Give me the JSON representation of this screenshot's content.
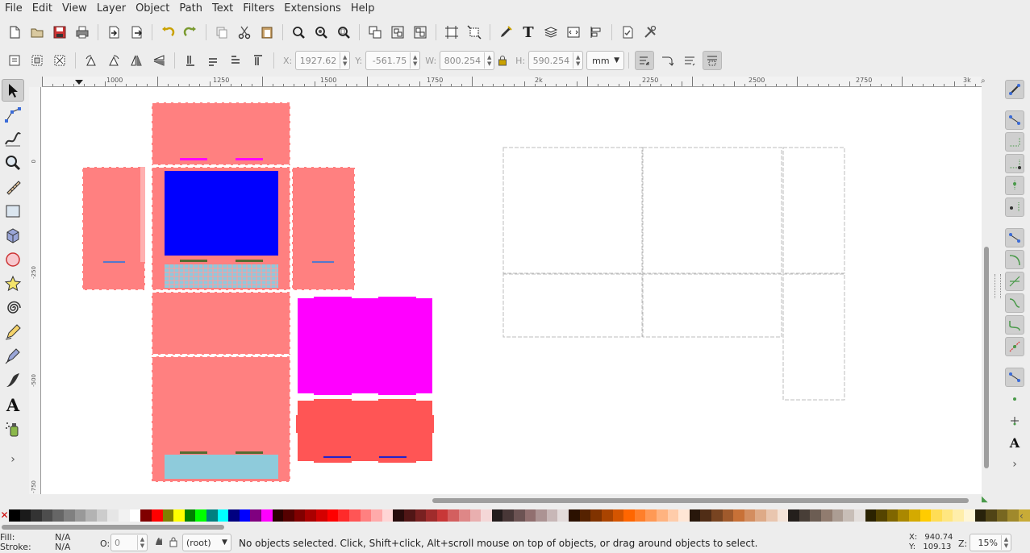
{
  "menu": [
    "File",
    "Edit",
    "View",
    "Layer",
    "Object",
    "Path",
    "Text",
    "Filters",
    "Extensions",
    "Help"
  ],
  "toolbar_icons": [
    "new-document-icon",
    "open-icon",
    "save-icon",
    "print-icon",
    "import-icon",
    "export-icon",
    "undo-icon",
    "redo-icon",
    "duplicate-icon",
    "cut-icon",
    "paste-icon",
    "zoom-selection-icon",
    "zoom-drawing-icon",
    "zoom-page-icon",
    "group-icon",
    "ungroup-icon",
    "clone-icon",
    "align-icon",
    "transform-icon",
    "fill-stroke-icon",
    "text-tool-icon",
    "layers-icon",
    "xml-editor-icon",
    "align-distribute-icon",
    "document-properties-icon",
    "preferences-icon"
  ],
  "ctrl": {
    "x_label": "X:",
    "x_value": "1927.62",
    "y_label": "Y:",
    "y_value": "-561.75",
    "w_label": "W:",
    "w_value": "800.254",
    "h_label": "H:",
    "h_value": "590.254",
    "unit": "mm"
  },
  "tools": [
    "selector-icon",
    "node-icon",
    "tweak-icon",
    "zoom-icon",
    "measure-icon",
    "rectangle-icon",
    "3dbox-icon",
    "ellipse-icon",
    "star-icon",
    "spiral-icon",
    "pencil-icon",
    "pen-icon",
    "calligraphy-icon",
    "text-icon",
    "spray-icon"
  ],
  "ruler": {
    "h_labels": [
      "1000",
      "1250",
      "1500",
      "1750",
      "2k",
      "2250",
      "2500",
      "2750",
      "3k"
    ],
    "v_labels": [
      "0",
      "-250",
      "-500",
      "-750"
    ]
  },
  "palette": [
    "#000000",
    "#1a1a1a",
    "#333333",
    "#4d4d4d",
    "#666666",
    "#808080",
    "#999999",
    "#b3b3b3",
    "#cccccc",
    "#e6e6e6",
    "#f2f2f2",
    "#ffffff",
    "#800000",
    "#ff0000",
    "#808000",
    "#ffff00",
    "#008000",
    "#00ff00",
    "#008080",
    "#00ffff",
    "#000080",
    "#0000ff",
    "#800080",
    "#ff00ff",
    "#2b0000",
    "#550000",
    "#800000",
    "#aa0000",
    "#d40000",
    "#ff0000",
    "#ff2a2a",
    "#ff5555",
    "#ff8080",
    "#ffaaaa",
    "#ffd5d5",
    "#280b0b",
    "#501616",
    "#782121",
    "#a02c2c",
    "#c83737",
    "#d35f5f",
    "#de8787",
    "#e9afaf",
    "#f4d7d7",
    "#241c1c",
    "#483737",
    "#6c5353",
    "#916f6f",
    "#ac9393",
    "#c8b7b7",
    "#e3dbdb",
    "#2b1100",
    "#552200",
    "#803300",
    "#aa4400",
    "#d45500",
    "#ff6600",
    "#ff7f2a",
    "#ff9955",
    "#ffb380",
    "#ffccaa",
    "#ffe6d5",
    "#28170b",
    "#502d16",
    "#784421",
    "#a05a2c",
    "#c87137",
    "#d38d5f",
    "#deaa87",
    "#e9c6af",
    "#f4e3d7",
    "#241f1c",
    "#483e37",
    "#6c5d53",
    "#917c6f",
    "#ac9d93",
    "#c8beb7",
    "#e3dedb",
    "#2b2200",
    "#554400",
    "#806600",
    "#aa8800",
    "#d4aa00",
    "#ffcc00",
    "#ffdd55",
    "#ffe680",
    "#ffeeaa",
    "#fff6d5",
    "#28220b",
    "#504416",
    "#786721",
    "#a0892c",
    "#c8ab37"
  ],
  "status": {
    "fill_label": "Fill:",
    "fill_value": "N/A",
    "stroke_label": "Stroke:",
    "stroke_value": "N/A",
    "opacity_label": "O:",
    "opacity_value": "0",
    "layer": "(root)",
    "message": "No objects selected. Click, Shift+click, Alt+scroll mouse on top of objects, or drag around objects to select.",
    "x_label": "X:",
    "x_value": "940.74",
    "y_label": "Y:",
    "y_value": "109.13",
    "zoom_label": "Z:",
    "zoom_value": "15%"
  }
}
